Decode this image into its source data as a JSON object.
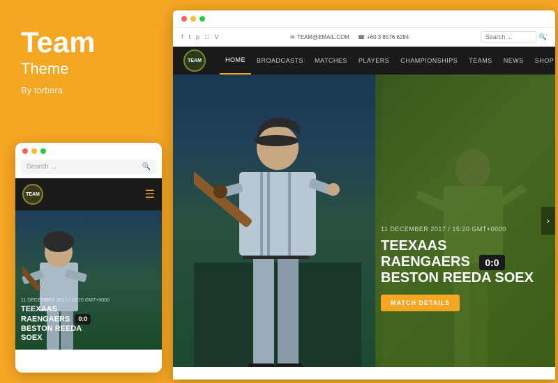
{
  "brand": {
    "title": "Team",
    "subtitle": "Theme",
    "author": "By torbara"
  },
  "mobile": {
    "search_placeholder": "Search ...",
    "logo_text": "TEAM",
    "match_date": "11 DECEMBER 2017 / 15:20 GMT+0000",
    "team1": "TEEXAAS",
    "team2": "RAENGAERS",
    "team3": "BESTON REEDA",
    "team4": "SOEX",
    "score": "0:0"
  },
  "desktop": {
    "top_bar": {
      "email": "TEAM@EMAIL.COM",
      "phone": "+60 3 8576 6284",
      "search_placeholder": "Search ..."
    },
    "nav": {
      "logo_text": "TEAM",
      "items": [
        "HOME",
        "BROADCASTS",
        "MATCHES",
        "PLAYERS",
        "CHAMPIONSHIPS",
        "TEAMS",
        "NEWS",
        "SHOP"
      ]
    },
    "hero": {
      "date": "11 DECEMBER 2017 / 15:20 GMT+0000",
      "team1": "TEEXAAS RAENGAERS",
      "team2": "BESTON REEDA SOEX",
      "score": "0:0",
      "button_label": "MATCH DETAILS"
    }
  },
  "window_dots": {
    "red": "#FF5F57",
    "yellow": "#FFBD2E",
    "green": "#28CA41"
  }
}
